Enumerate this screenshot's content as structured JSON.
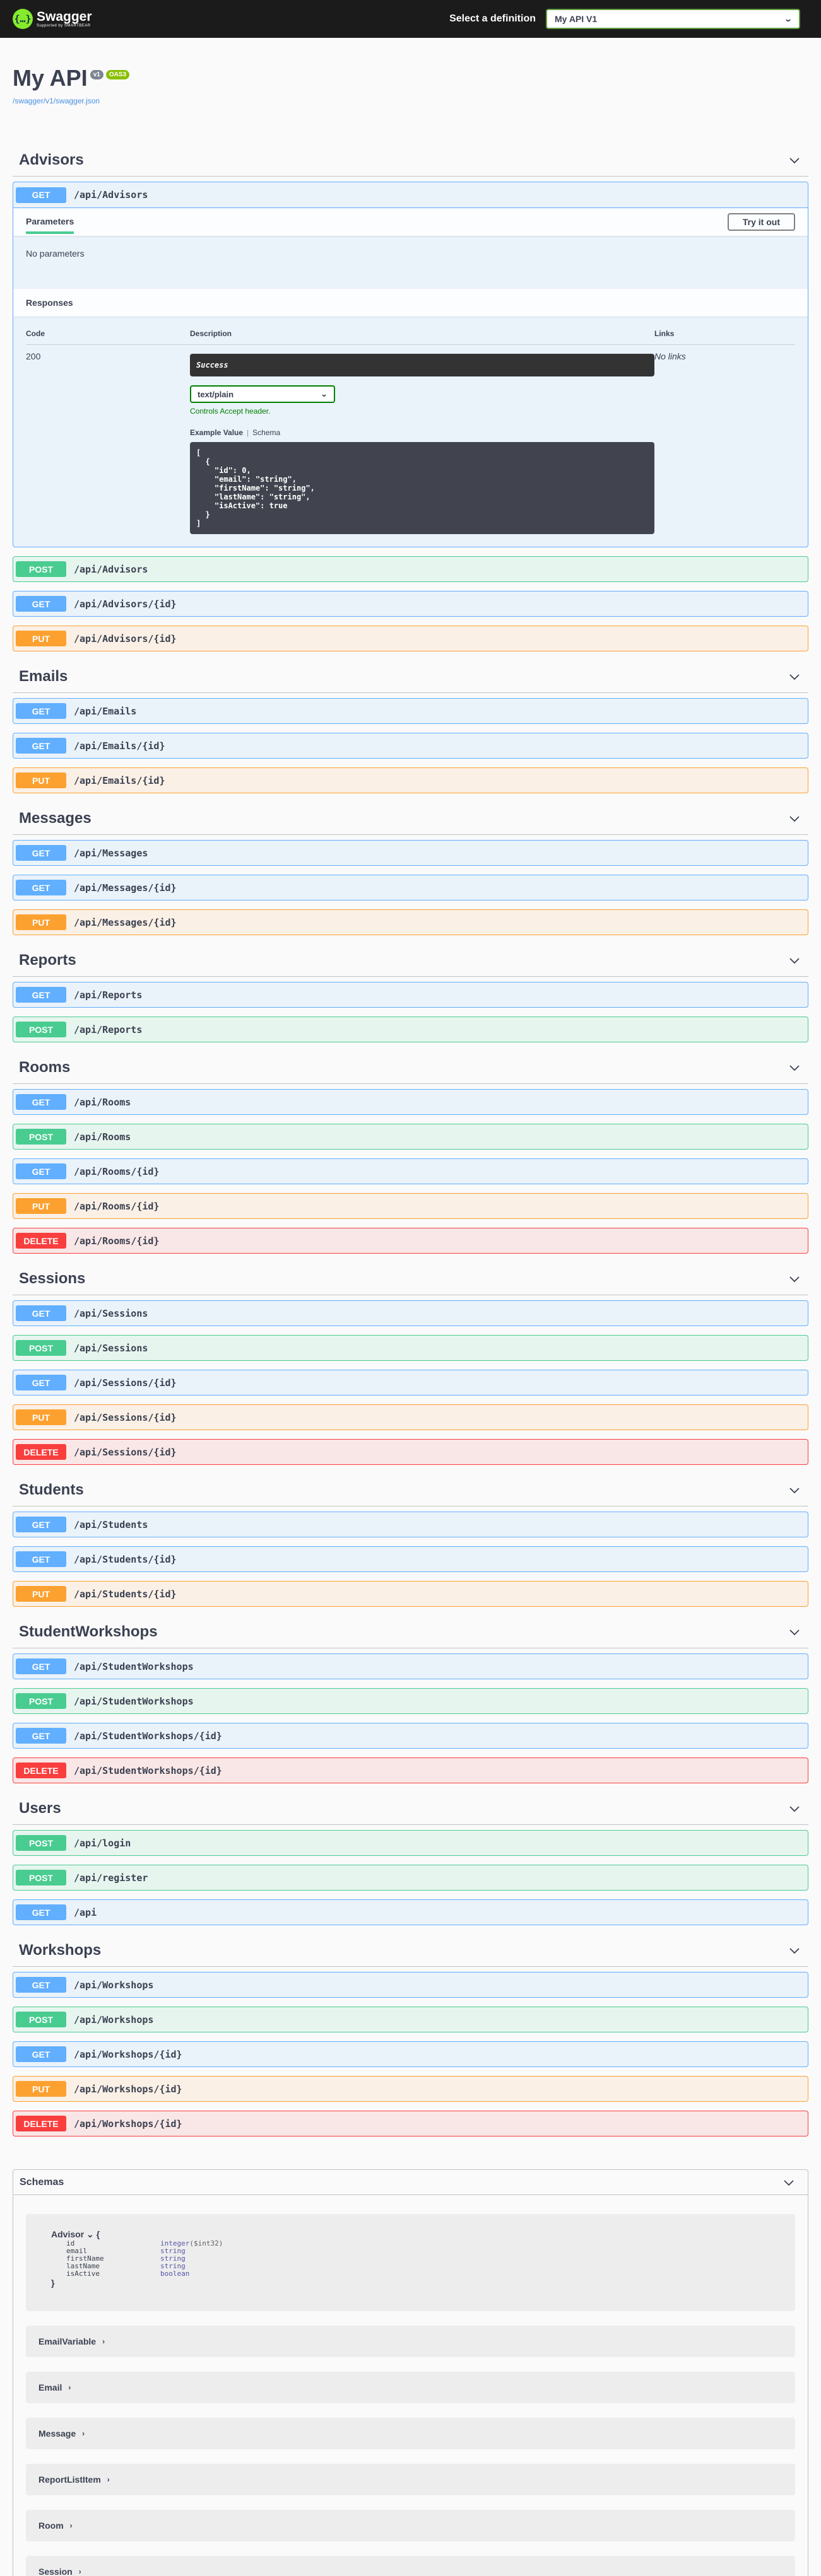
{
  "topbar": {
    "brand": "Swagger",
    "brand_sub": "Supported by SMARTBEAR",
    "definition_label": "Select a definition",
    "definition_value": "My API V1"
  },
  "info": {
    "title": "My API",
    "version_badge": "v1",
    "oas_badge": "OAS3",
    "spec_link": "/swagger/v1/swagger.json"
  },
  "expanded": {
    "parameters_tab": "Parameters",
    "try_button": "Try it out",
    "no_parameters": "No parameters",
    "responses_title": "Responses",
    "col_code": "Code",
    "col_description": "Description",
    "col_links": "Links",
    "code": "200",
    "description": "Success",
    "media_type": "text/plain",
    "accept_note": "Controls Accept header.",
    "example_tab": "Example Value",
    "schema_tab": "Schema",
    "example_json": "[\n  {\n    \"id\": 0,\n    \"email\": \"string\",\n    \"firstName\": \"string\",\n    \"lastName\": \"string\",\n    \"isActive\": true\n  }\n]",
    "no_links": "No links"
  },
  "tags": [
    {
      "name": "Advisors",
      "ops": [
        {
          "method": "POST",
          "path": "/api/Advisors"
        },
        {
          "method": "GET",
          "path": "/api/Advisors/{id}"
        },
        {
          "method": "PUT",
          "path": "/api/Advisors/{id}"
        }
      ]
    },
    {
      "name": "Emails",
      "ops": [
        {
          "method": "GET",
          "path": "/api/Emails"
        },
        {
          "method": "GET",
          "path": "/api/Emails/{id}"
        },
        {
          "method": "PUT",
          "path": "/api/Emails/{id}"
        }
      ]
    },
    {
      "name": "Messages",
      "ops": [
        {
          "method": "GET",
          "path": "/api/Messages"
        },
        {
          "method": "GET",
          "path": "/api/Messages/{id}"
        },
        {
          "method": "PUT",
          "path": "/api/Messages/{id}"
        }
      ]
    },
    {
      "name": "Reports",
      "ops": [
        {
          "method": "GET",
          "path": "/api/Reports"
        },
        {
          "method": "POST",
          "path": "/api/Reports"
        }
      ]
    },
    {
      "name": "Rooms",
      "ops": [
        {
          "method": "GET",
          "path": "/api/Rooms"
        },
        {
          "method": "POST",
          "path": "/api/Rooms"
        },
        {
          "method": "GET",
          "path": "/api/Rooms/{id}"
        },
        {
          "method": "PUT",
          "path": "/api/Rooms/{id}"
        },
        {
          "method": "DELETE",
          "path": "/api/Rooms/{id}"
        }
      ]
    },
    {
      "name": "Sessions",
      "ops": [
        {
          "method": "GET",
          "path": "/api/Sessions"
        },
        {
          "method": "POST",
          "path": "/api/Sessions"
        },
        {
          "method": "GET",
          "path": "/api/Sessions/{id}"
        },
        {
          "method": "PUT",
          "path": "/api/Sessions/{id}"
        },
        {
          "method": "DELETE",
          "path": "/api/Sessions/{id}"
        }
      ]
    },
    {
      "name": "Students",
      "ops": [
        {
          "method": "GET",
          "path": "/api/Students"
        },
        {
          "method": "GET",
          "path": "/api/Students/{id}"
        },
        {
          "method": "PUT",
          "path": "/api/Students/{id}"
        }
      ]
    },
    {
      "name": "StudentWorkshops",
      "ops": [
        {
          "method": "GET",
          "path": "/api/StudentWorkshops"
        },
        {
          "method": "POST",
          "path": "/api/StudentWorkshops"
        },
        {
          "method": "GET",
          "path": "/api/StudentWorkshops/{id}"
        },
        {
          "method": "DELETE",
          "path": "/api/StudentWorkshops/{id}"
        }
      ]
    },
    {
      "name": "Users",
      "ops": [
        {
          "method": "POST",
          "path": "/api/login"
        },
        {
          "method": "POST",
          "path": "/api/register"
        },
        {
          "method": "GET",
          "path": "/api"
        }
      ]
    },
    {
      "name": "Workshops",
      "ops": [
        {
          "method": "GET",
          "path": "/api/Workshops"
        },
        {
          "method": "POST",
          "path": "/api/Workshops"
        },
        {
          "method": "GET",
          "path": "/api/Workshops/{id}"
        },
        {
          "method": "PUT",
          "path": "/api/Workshops/{id}"
        },
        {
          "method": "DELETE",
          "path": "/api/Workshops/{id}"
        }
      ]
    }
  ],
  "first_op": {
    "method": "GET",
    "path": "/api/Advisors"
  },
  "schemas": {
    "title": "Schemas",
    "open_model": {
      "name": "Advisor",
      "open_brace": "{",
      "close_brace": "}",
      "props": [
        {
          "name": "id",
          "type": "integer",
          "format": "($int32)"
        },
        {
          "name": "email",
          "type": "string",
          "format": ""
        },
        {
          "name": "firstName",
          "type": "string",
          "format": ""
        },
        {
          "name": "lastName",
          "type": "string",
          "format": ""
        },
        {
          "name": "isActive",
          "type": "boolean",
          "format": ""
        }
      ]
    },
    "closed_models": [
      "EmailVariable",
      "Email",
      "Message",
      "ReportListItem",
      "Room",
      "Session"
    ]
  }
}
